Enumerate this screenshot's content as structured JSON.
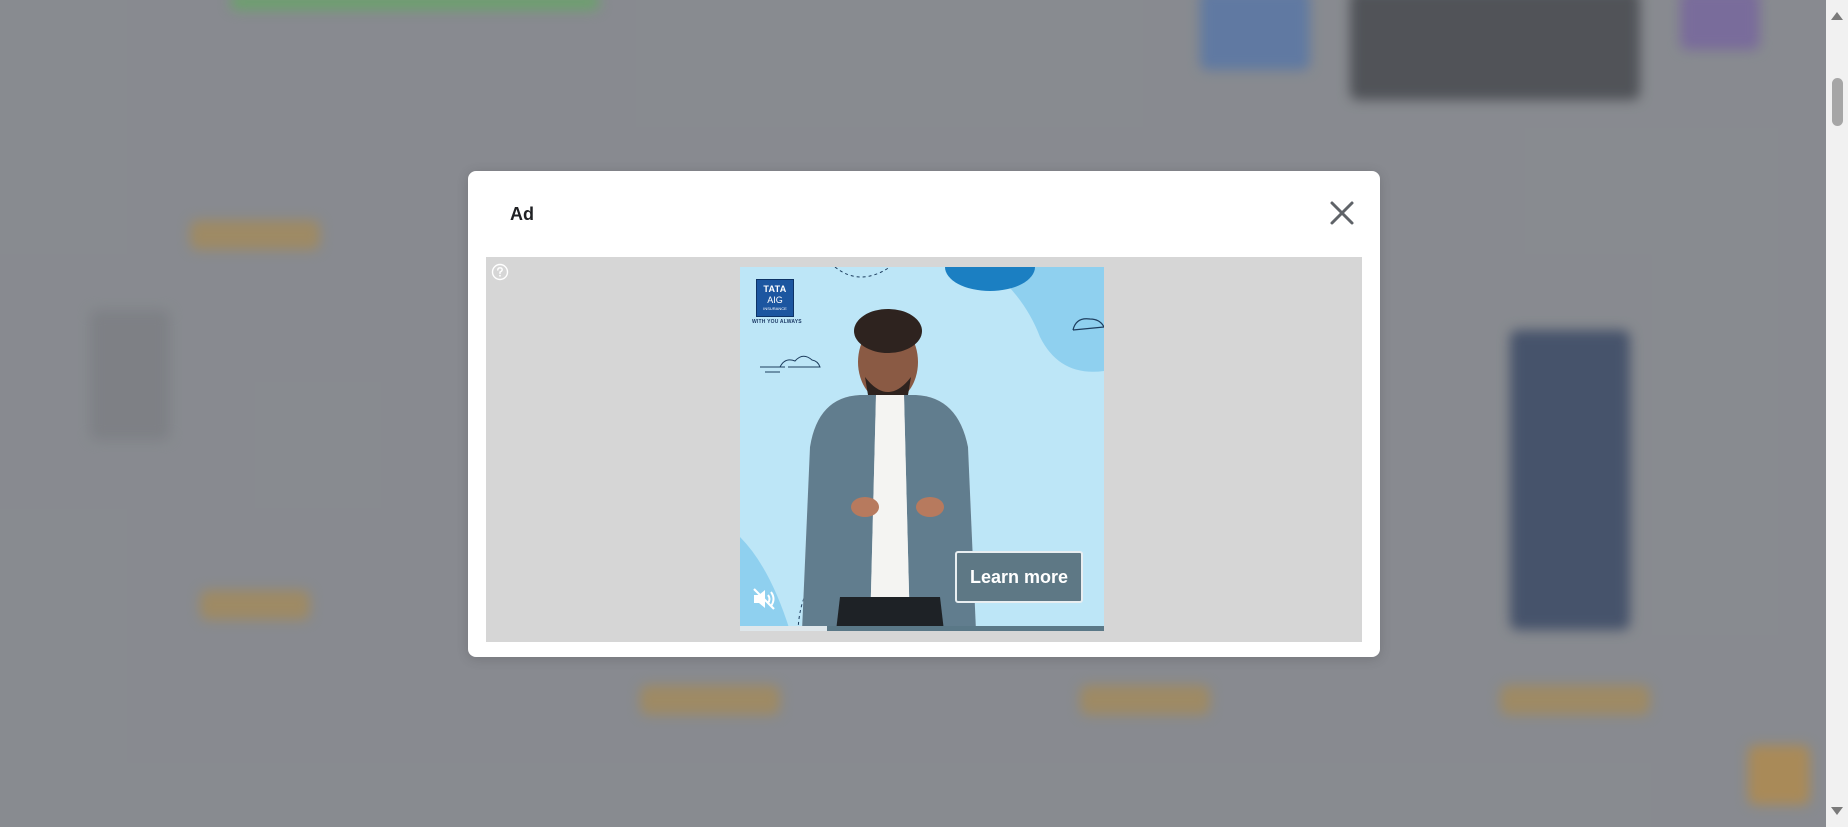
{
  "modal": {
    "title": "Ad"
  },
  "ad": {
    "brand_line1": "TATA",
    "brand_line2": "AIG",
    "brand_line3": "INSURANCE",
    "tagline": "WITH YOU ALWAYS",
    "cta_label": "Learn more",
    "video_progress": 0.24,
    "muted": true
  },
  "icons": {
    "close": "close-icon",
    "help": "help-circle-icon",
    "mute": "speaker-muted-icon"
  },
  "colors": {
    "cta_background": "#5e7885",
    "creative_background": "#bde6f7",
    "brand_blue": "#1c56a0"
  }
}
